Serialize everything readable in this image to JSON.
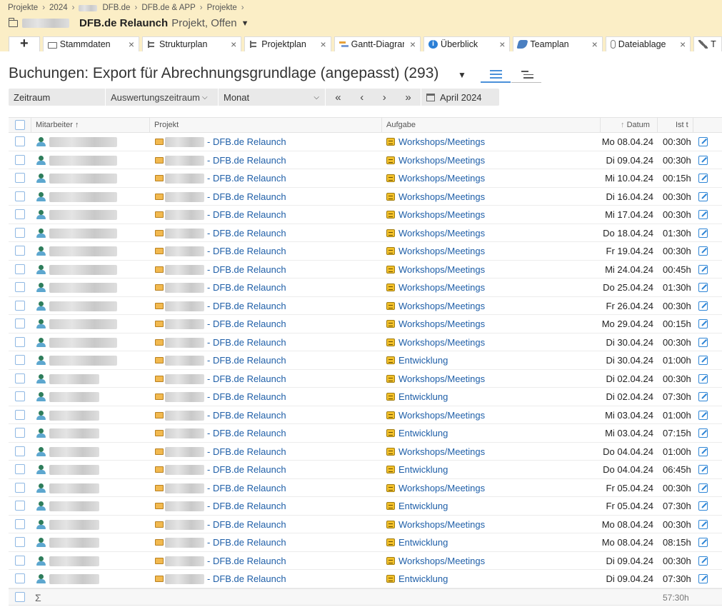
{
  "breadcrumb": [
    "Projekte",
    "2024",
    "DFB.de",
    "DFB.de & APP",
    "Projekte"
  ],
  "project": {
    "title": "DFB.de Relaunch",
    "status": "Projekt, Offen"
  },
  "tabs": [
    {
      "label": "Stammdaten",
      "icon": "folder-icon"
    },
    {
      "label": "Strukturplan",
      "icon": "structure-icon"
    },
    {
      "label": "Projektplan",
      "icon": "structure-icon"
    },
    {
      "label": "Gantt-Diagramm",
      "icon": "gantt-icon"
    },
    {
      "label": "Überblick",
      "icon": "info-icon"
    },
    {
      "label": "Teamplan",
      "icon": "team-icon"
    },
    {
      "label": "Dateiablage",
      "icon": "paperclip-icon"
    },
    {
      "label": "T",
      "icon": "tools-icon"
    }
  ],
  "page": {
    "title": "Buchungen: Export für Abrechnungsgrundlage (angepasst) (293)"
  },
  "filters": {
    "zeitraum": "Zeitraum",
    "auswertung": "Auswertungszeitraum",
    "period": "Monat",
    "month": "April 2024",
    "nav": [
      "«",
      "‹",
      "›",
      "»"
    ]
  },
  "table": {
    "headers": {
      "mitarbeiter": "Mitarbeiter",
      "projekt": "Projekt",
      "aufgabe": "Aufgabe",
      "datum": "Datum",
      "ist": "Ist t"
    },
    "rows": [
      {
        "project": "- DFB.de Relaunch",
        "task": "Workshops/Meetings",
        "date": "Mo 08.04.24",
        "hours": "00:30h"
      },
      {
        "project": "- DFB.de Relaunch",
        "task": "Workshops/Meetings",
        "date": "Di 09.04.24",
        "hours": "00:30h"
      },
      {
        "project": "- DFB.de Relaunch",
        "task": "Workshops/Meetings",
        "date": "Mi 10.04.24",
        "hours": "00:15h"
      },
      {
        "project": "- DFB.de Relaunch",
        "task": "Workshops/Meetings",
        "date": "Di 16.04.24",
        "hours": "00:30h"
      },
      {
        "project": "- DFB.de Relaunch",
        "task": "Workshops/Meetings",
        "date": "Mi 17.04.24",
        "hours": "00:30h"
      },
      {
        "project": "- DFB.de Relaunch",
        "task": "Workshops/Meetings",
        "date": "Do 18.04.24",
        "hours": "01:30h"
      },
      {
        "project": "- DFB.de Relaunch",
        "task": "Workshops/Meetings",
        "date": "Fr 19.04.24",
        "hours": "00:30h"
      },
      {
        "project": "- DFB.de Relaunch",
        "task": "Workshops/Meetings",
        "date": "Mi 24.04.24",
        "hours": "00:45h"
      },
      {
        "project": "- DFB.de Relaunch",
        "task": "Workshops/Meetings",
        "date": "Do 25.04.24",
        "hours": "01:30h"
      },
      {
        "project": "- DFB.de Relaunch",
        "task": "Workshops/Meetings",
        "date": "Fr 26.04.24",
        "hours": "00:30h"
      },
      {
        "project": "- DFB.de Relaunch",
        "task": "Workshops/Meetings",
        "date": "Mo 29.04.24",
        "hours": "00:15h"
      },
      {
        "project": "- DFB.de Relaunch",
        "task": "Workshops/Meetings",
        "date": "Di 30.04.24",
        "hours": "00:30h"
      },
      {
        "project": "- DFB.de Relaunch",
        "task": "Entwicklung",
        "date": "Di 30.04.24",
        "hours": "01:00h"
      },
      {
        "project": "- DFB.de Relaunch",
        "task": "Workshops/Meetings",
        "date": "Di 02.04.24",
        "hours": "00:30h"
      },
      {
        "project": "- DFB.de Relaunch",
        "task": "Entwicklung",
        "date": "Di 02.04.24",
        "hours": "07:30h"
      },
      {
        "project": "- DFB.de Relaunch",
        "task": "Workshops/Meetings",
        "date": "Mi 03.04.24",
        "hours": "01:00h"
      },
      {
        "project": "- DFB.de Relaunch",
        "task": "Entwicklung",
        "date": "Mi 03.04.24",
        "hours": "07:15h"
      },
      {
        "project": "- DFB.de Relaunch",
        "task": "Workshops/Meetings",
        "date": "Do 04.04.24",
        "hours": "01:00h"
      },
      {
        "project": "- DFB.de Relaunch",
        "task": "Entwicklung",
        "date": "Do 04.04.24",
        "hours": "06:45h"
      },
      {
        "project": "- DFB.de Relaunch",
        "task": "Workshops/Meetings",
        "date": "Fr 05.04.24",
        "hours": "00:30h"
      },
      {
        "project": "- DFB.de Relaunch",
        "task": "Entwicklung",
        "date": "Fr 05.04.24",
        "hours": "07:30h"
      },
      {
        "project": "- DFB.de Relaunch",
        "task": "Workshops/Meetings",
        "date": "Mo 08.04.24",
        "hours": "00:30h"
      },
      {
        "project": "- DFB.de Relaunch",
        "task": "Entwicklung",
        "date": "Mo 08.04.24",
        "hours": "08:15h"
      },
      {
        "project": "- DFB.de Relaunch",
        "task": "Workshops/Meetings",
        "date": "Di 09.04.24",
        "hours": "00:30h"
      },
      {
        "project": "- DFB.de Relaunch",
        "task": "Entwicklung",
        "date": "Di 09.04.24",
        "hours": "07:30h"
      }
    ],
    "sum_symbol": "Σ",
    "sum_hours": "57:30h"
  }
}
